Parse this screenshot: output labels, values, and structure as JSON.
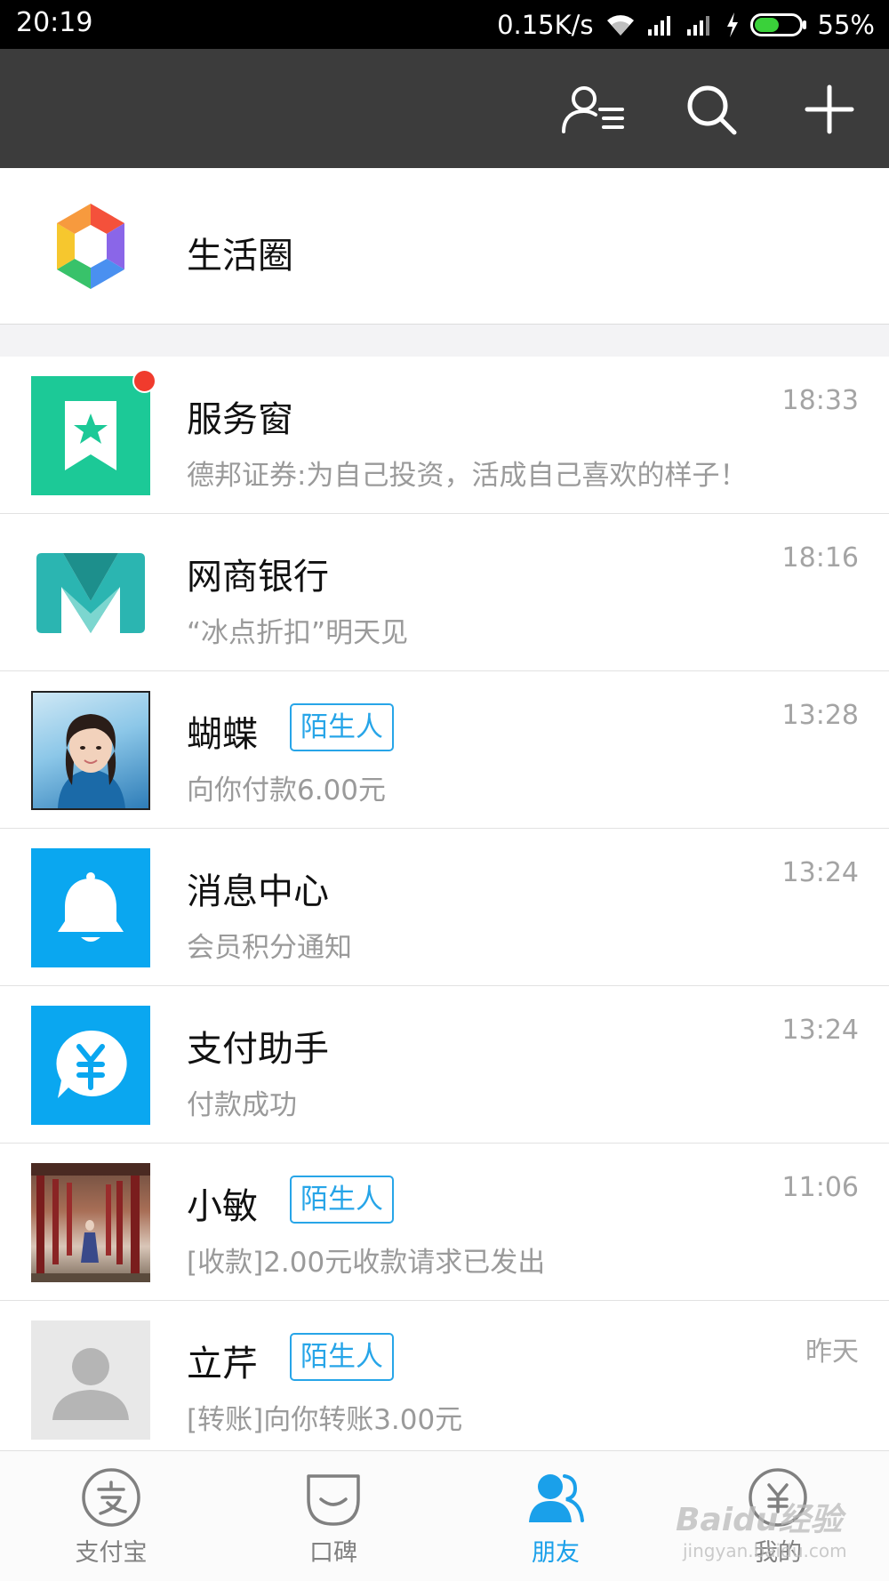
{
  "status_bar": {
    "time": "20:19",
    "net_speed": "0.15K/s",
    "battery": "55%",
    "battery_level": 0.55,
    "icons": [
      "wifi-icon",
      "signal-icon",
      "signal-icon",
      "charging-icon",
      "battery-icon"
    ]
  },
  "app_bar": {
    "icons": [
      "contacts-icon",
      "search-icon",
      "plus-icon"
    ]
  },
  "life_circle": {
    "label": "生活圈",
    "icon": "life-circle-logo"
  },
  "chats": [
    {
      "name": "服务窗",
      "preview": "德邦证券:为自己投资，活成自己喜欢的样子！",
      "time": "18:33",
      "tag": "",
      "unread_dot": true,
      "avatar": "service-window-icon",
      "avatar_color": "#1cc997"
    },
    {
      "name": "网商银行",
      "preview": "“冰点折扣”明天见",
      "time": "18:16",
      "tag": "",
      "unread_dot": false,
      "avatar": "mybank-logo",
      "avatar_color": "#2bb5b1"
    },
    {
      "name": "蝴蝶",
      "preview": "向你付款6.00元",
      "time": "13:28",
      "tag": "陌生人",
      "unread_dot": false,
      "avatar": "user-photo",
      "avatar_color": "#3f8fbf"
    },
    {
      "name": "消息中心",
      "preview": "会员积分通知",
      "time": "13:24",
      "tag": "",
      "unread_dot": false,
      "avatar": "bell-icon",
      "avatar_color": "#0aa7f0"
    },
    {
      "name": "支付助手",
      "preview": "付款成功",
      "time": "13:24",
      "tag": "",
      "unread_dot": false,
      "avatar": "yuan-chat-icon",
      "avatar_color": "#0aa7f0"
    },
    {
      "name": "小敏",
      "preview": "[收款]2.00元收款请求已发出",
      "time": "11:06",
      "tag": "陌生人",
      "unread_dot": false,
      "avatar": "user-photo",
      "avatar_color": "#8a2b2b"
    },
    {
      "name": "立芹",
      "preview": "[转账]向你转账3.00元",
      "time": "昨天",
      "tag": "陌生人",
      "unread_dot": false,
      "avatar": "default-avatar-icon",
      "avatar_color": "#e8e8e8"
    }
  ],
  "tabs": [
    {
      "label": "支付宝",
      "icon": "alipay-icon",
      "active": false
    },
    {
      "label": "口碑",
      "icon": "koubei-icon",
      "active": false
    },
    {
      "label": "朋友",
      "icon": "friends-icon",
      "active": true
    },
    {
      "label": "我的",
      "icon": "my-yuan-icon",
      "active": false
    }
  ],
  "colors": {
    "accent": "#1aa0ea",
    "app_bar": "#3c3c3c",
    "badge": "#f03b2d",
    "tag": "#27a5e8"
  },
  "watermark": {
    "line1": "Baidu经验",
    "line2": "jingyan.baidu.com"
  }
}
